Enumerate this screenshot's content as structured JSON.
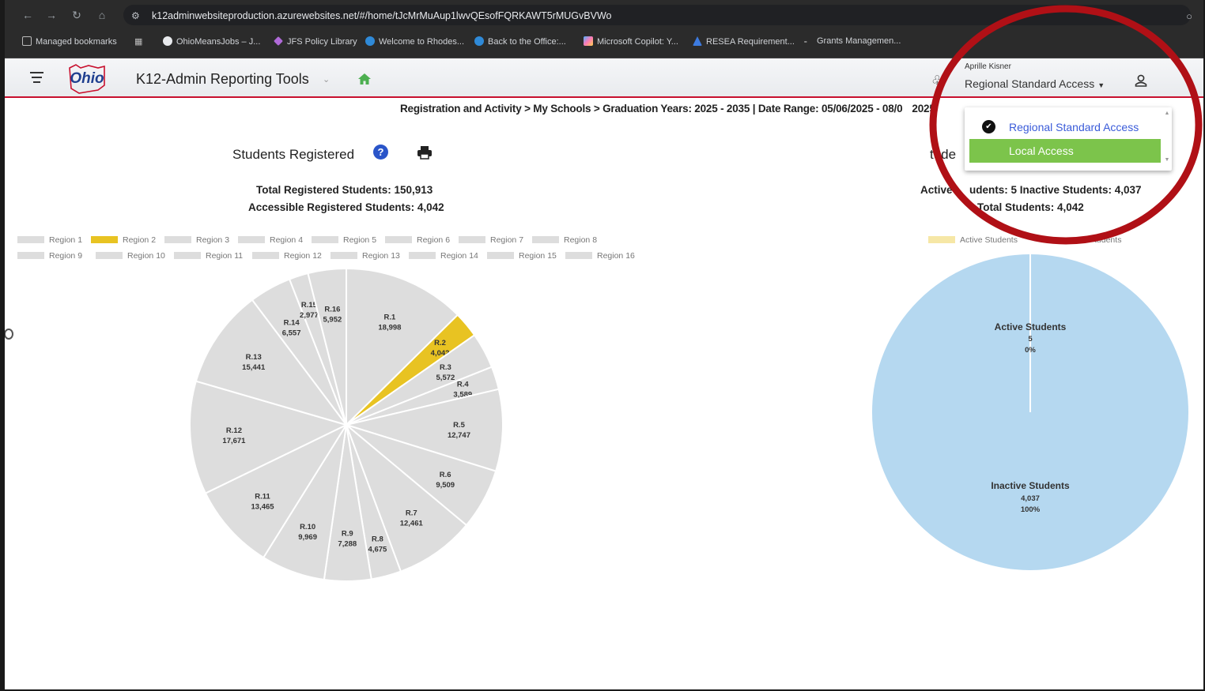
{
  "browser": {
    "url": "k12adminwebsiteproduction.azurewebsites.net/#/home/tJcMrMuAup1lwvQEsofFQRKAWT5rMUGvBVWo",
    "bookmarks": [
      "Managed bookmarks",
      "OhioMeansJobs – J...",
      "JFS Policy Library",
      "Welcome to Rhodes...",
      "Back to the Office:...",
      "Microsoft Copilot: Y...",
      "RESEA Requirement...",
      "Grants Managemen..."
    ]
  },
  "header": {
    "app_title": "K12-Admin Reporting Tools",
    "logo_text": "Ohio",
    "user_name": "Aprille Kisner",
    "access_level": "Regional Standard Access"
  },
  "breadcrumb": "Registration and Activity > My Schools > Graduation Years: 2025 - 2035 | Date Range: 05/06/2025 - 08/0",
  "breadcrumb_tail": "2025",
  "left_panel": {
    "title": "Students Registered",
    "total_registered": "Total Registered Students: 150,913",
    "accessible_registered": "Accessible Registered Students: 4,042"
  },
  "right_panel": {
    "title_fragment": "tude",
    "stat_line1_a": "Active",
    "stat_line1_b": "udents: 5 Inactive Students: 4,037",
    "stat_line2": "Total Students: 4,042",
    "legend_a": "Active Students",
    "legend_b": "tudents"
  },
  "dropdown": {
    "options": [
      "Regional Standard Access",
      "Local Access"
    ],
    "selected": "Regional Standard Access",
    "highlighted": "Local Access"
  },
  "colors": {
    "highlight_region": "#e8c322",
    "region_default": "#dddddd",
    "pie_right": "#b5d8f0",
    "annotation": "#b01016",
    "ohio_red": "#c8102e",
    "menu_green": "#7cc44b"
  },
  "chart_data": [
    {
      "type": "pie",
      "title": "Students Registered",
      "legend": [
        "Region 1",
        "Region 2",
        "Region 3",
        "Region 4",
        "Region 5",
        "Region 6",
        "Region 7",
        "Region 8",
        "Region 9",
        "Region 10",
        "Region 11",
        "Region 12",
        "Region 13",
        "Region 14",
        "Region 15",
        "Region 16"
      ],
      "slices": [
        {
          "label": "R.1",
          "value": 18998,
          "value_label": "18,998"
        },
        {
          "label": "R.2",
          "value": 4042,
          "value_label": "4,042",
          "highlighted": true
        },
        {
          "label": "R.3",
          "value": 5572,
          "value_label": "5,572"
        },
        {
          "label": "R.4",
          "value": 3589,
          "value_label": "3,589"
        },
        {
          "label": "R.5",
          "value": 12747,
          "value_label": "12,747"
        },
        {
          "label": "R.6",
          "value": 9509,
          "value_label": "9,509"
        },
        {
          "label": "R.7",
          "value": 12461,
          "value_label": "12,461"
        },
        {
          "label": "R.8",
          "value": 4675,
          "value_label": "4,675"
        },
        {
          "label": "R.9",
          "value": 7288,
          "value_label": "7,288"
        },
        {
          "label": "R.10",
          "value": 9969,
          "value_label": "9,969"
        },
        {
          "label": "R.11",
          "value": 13465,
          "value_label": "13,465"
        },
        {
          "label": "R.12",
          "value": 17671,
          "value_label": "17,671"
        },
        {
          "label": "R.13",
          "value": 15441,
          "value_label": "15,441"
        },
        {
          "label": "R.14",
          "value": 6557,
          "value_label": "6,557"
        },
        {
          "label": "R.15",
          "value": 2977,
          "value_label": "2,977"
        },
        {
          "label": "R.16",
          "value": 5952,
          "value_label": "5,952"
        }
      ]
    },
    {
      "type": "pie",
      "slices": [
        {
          "label": "Active Students",
          "value": 5,
          "value_label": "5",
          "percent": "0%"
        },
        {
          "label": "Inactive Students",
          "value": 4037,
          "value_label": "4,037",
          "percent": "100%"
        }
      ]
    }
  ]
}
